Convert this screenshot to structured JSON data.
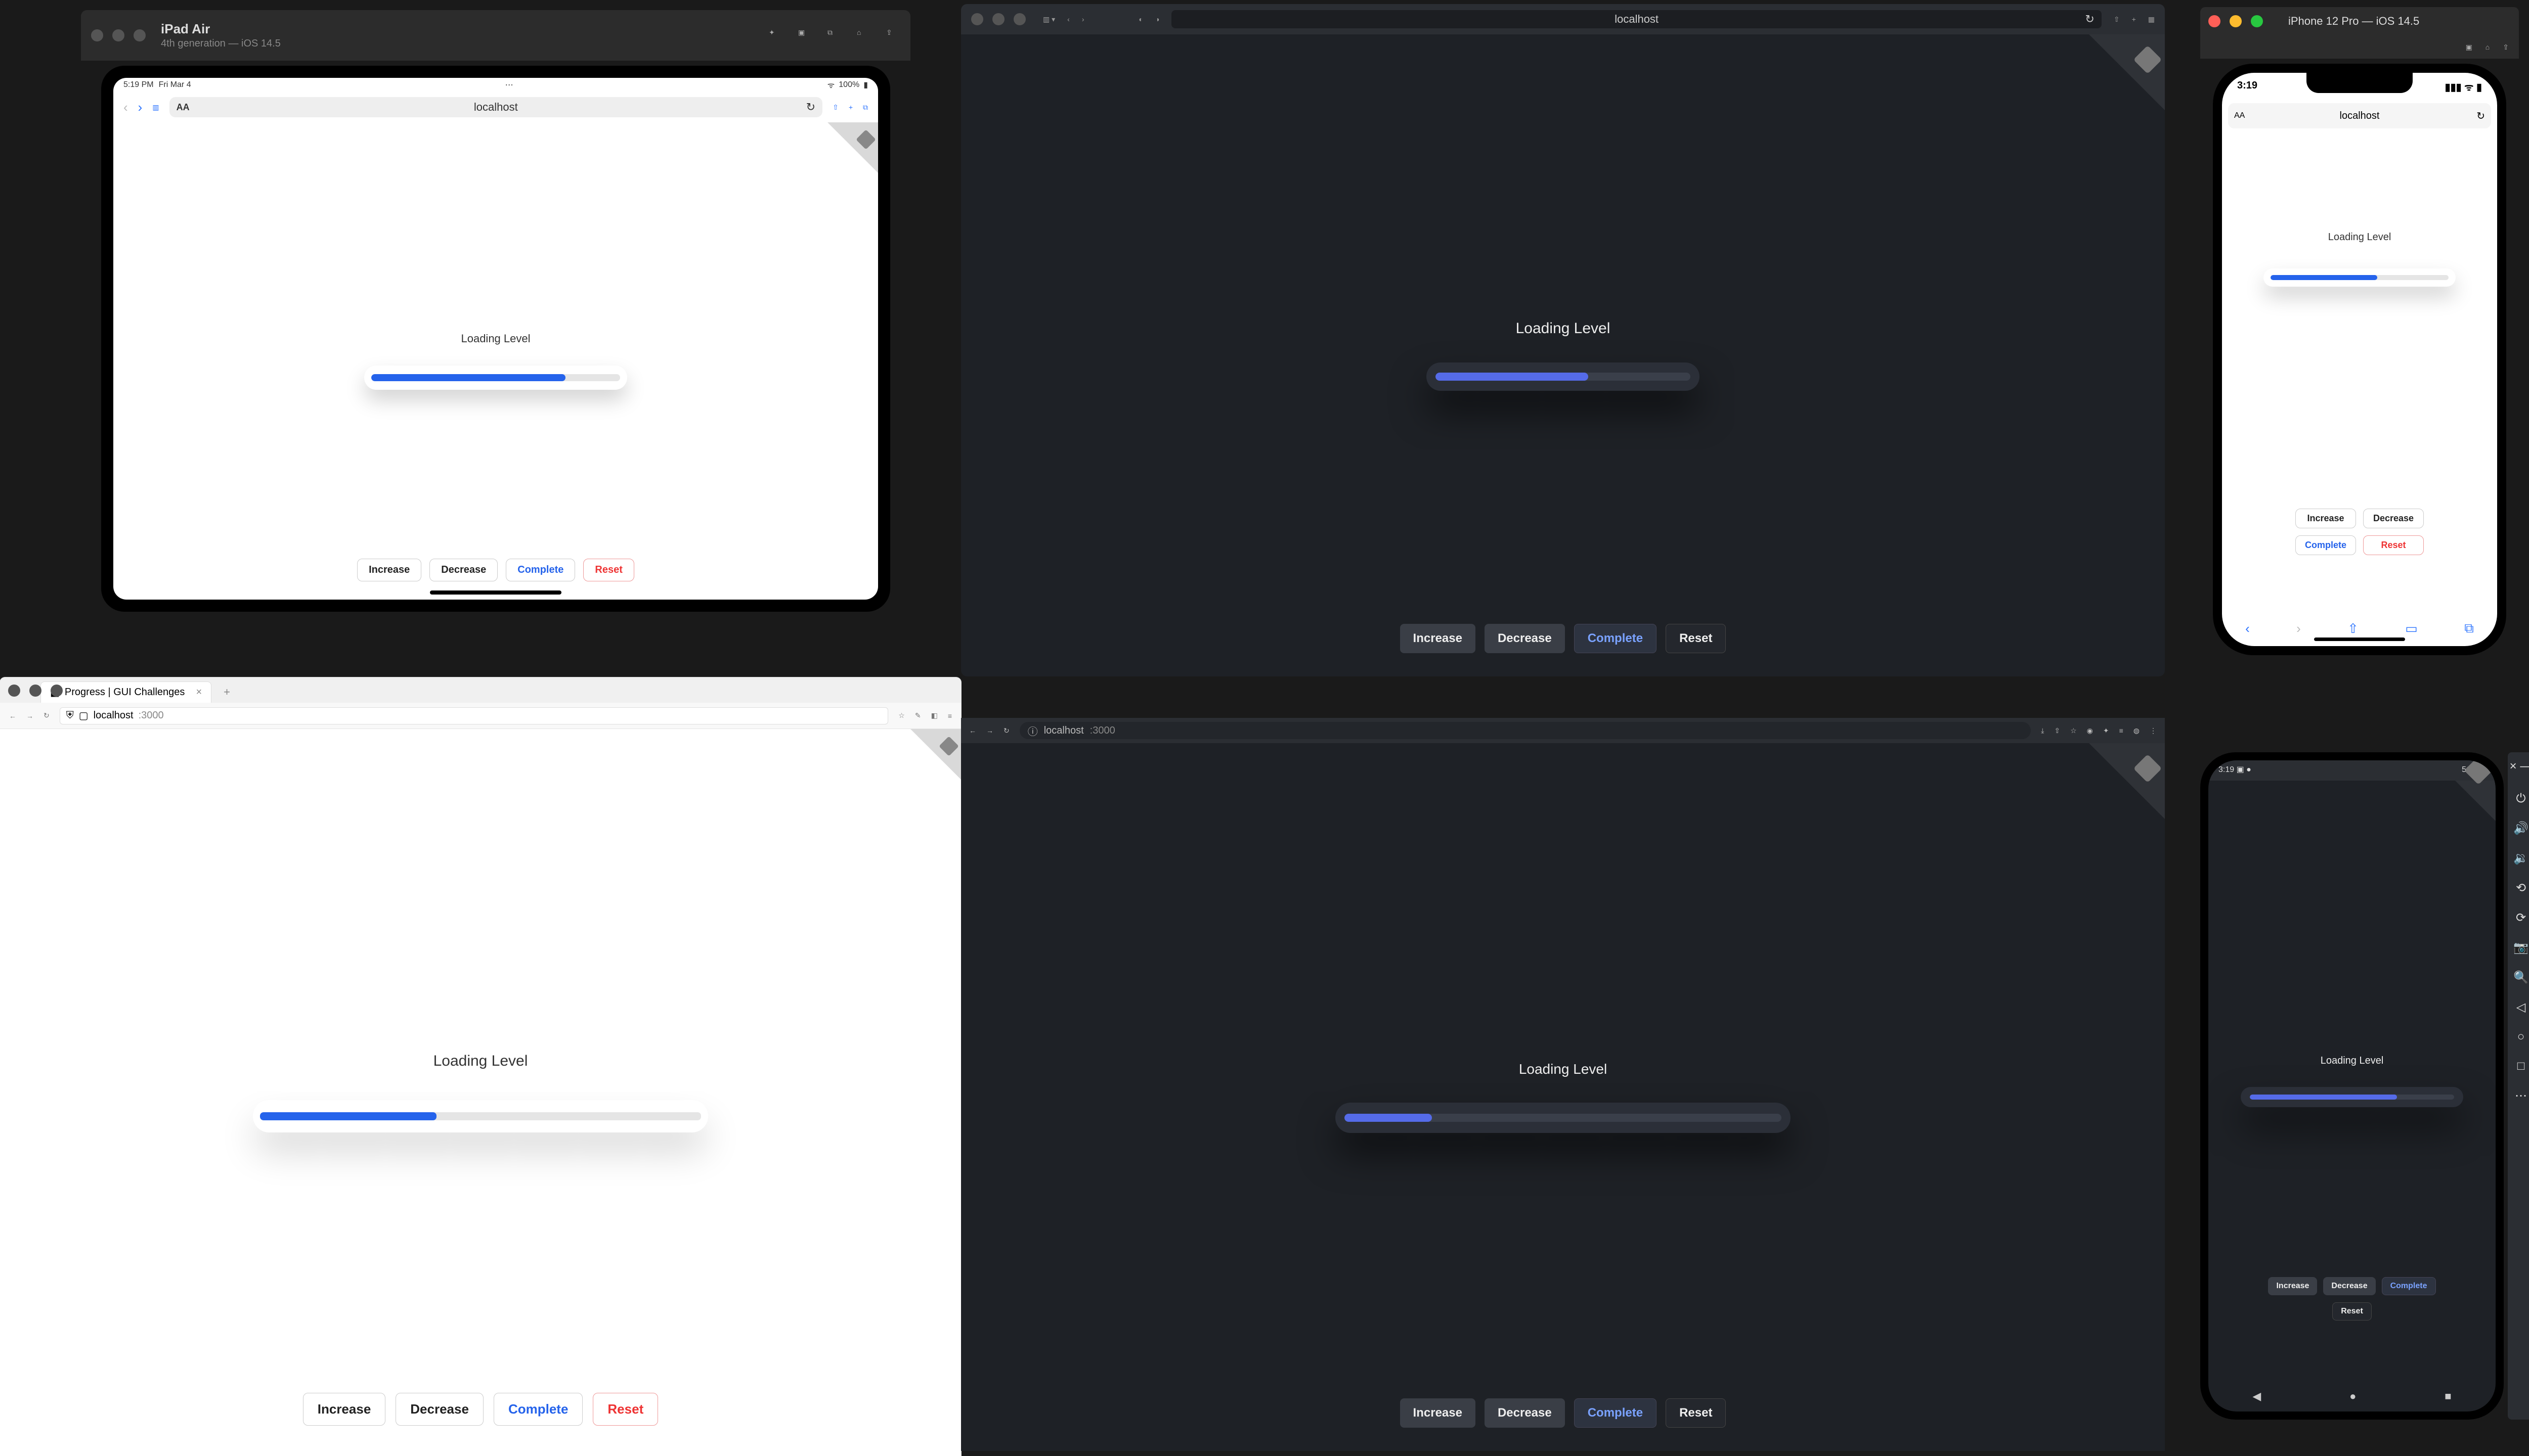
{
  "app_label": "Loading Level",
  "buttons": {
    "increase": "Increase",
    "decrease": "Decrease",
    "complete": "Complete",
    "reset": "Reset"
  },
  "progress_percent": {
    "ipad": 78,
    "safari": 60,
    "iphone": 60,
    "firefox": 40,
    "chrome": 20,
    "android": 72
  },
  "colors": {
    "accent_light": "#2563eb",
    "accent_dark": "#556be8",
    "danger": "#e33"
  },
  "ipad_sim": {
    "device": "iPad Air",
    "subtitle": "4th generation — iOS 14.5",
    "status_time": "5:19 PM",
    "status_date": "Fri Mar 4",
    "battery": "100%",
    "url": "localhost"
  },
  "safari": {
    "url": "localhost"
  },
  "iphone_sim": {
    "title": "iPhone 12 Pro — iOS 14.5",
    "status_time": "3:19",
    "url": "localhost"
  },
  "firefox": {
    "tab_title": "Progress | GUI Challenges",
    "host": "localhost",
    "port": ":3000"
  },
  "chrome": {
    "host": "localhost",
    "port": ":3000"
  },
  "android": {
    "status_time": "3:19"
  }
}
